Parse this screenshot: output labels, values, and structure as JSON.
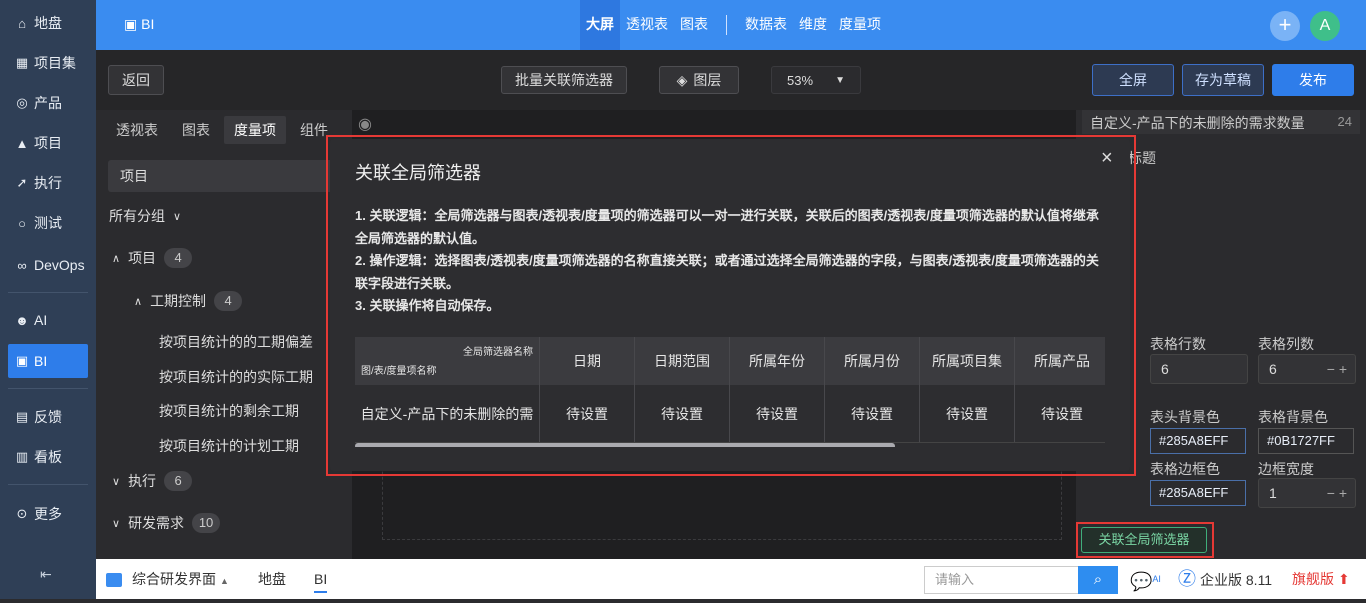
{
  "sidebar": {
    "items": [
      {
        "label": "地盘",
        "icon": "home-icon"
      },
      {
        "label": "项目集",
        "icon": "grid-icon"
      },
      {
        "label": "产品",
        "icon": "bulb-icon"
      },
      {
        "label": "项目",
        "icon": "rocket-icon"
      },
      {
        "label": "执行",
        "icon": "run-icon"
      },
      {
        "label": "测试",
        "icon": "search-icon"
      },
      {
        "label": "DevOps",
        "icon": "infinity-icon"
      },
      {
        "label": "AI",
        "icon": "robot-icon"
      },
      {
        "label": "BI",
        "icon": "chart-icon"
      },
      {
        "label": "反馈",
        "icon": "feedback-icon"
      },
      {
        "label": "看板",
        "icon": "board-icon"
      },
      {
        "label": "更多",
        "icon": "more-icon"
      }
    ],
    "active": "BI"
  },
  "topbar": {
    "brand": "BI",
    "tabs": [
      "大屏",
      "透视表",
      "图表",
      "数据表",
      "维度",
      "度量项"
    ],
    "active_tab": "大屏",
    "avatar_letter": "A",
    "plus": "+"
  },
  "toolbar": {
    "back": "返回",
    "batch_filter": "批量关联筛选器",
    "layers": "图层",
    "zoom": "53%",
    "fullscreen": "全屏",
    "save_draft": "存为草稿",
    "publish": "发布"
  },
  "left": {
    "tabs": [
      "透视表",
      "图表",
      "度量项",
      "组件"
    ],
    "active_tab": "度量项",
    "select_value": "项目",
    "group_label": "所有分组",
    "tree": {
      "project": {
        "label": "项目",
        "count": "4"
      },
      "schedule": {
        "label": "工期控制",
        "count": "4"
      },
      "leaves": [
        "按项目统计的的工期偏差",
        "按项目统计的的实际工期",
        "按项目统计的剩余工期",
        "按项目统计的计划工期"
      ],
      "exec": {
        "label": "执行",
        "count": "6"
      },
      "req": {
        "label": "研发需求",
        "count": "10"
      }
    }
  },
  "right": {
    "top_item": "自定义-产品下的未删除的需求数量",
    "top_num": "24",
    "title_label": "标题",
    "rows_label": "表格行数",
    "rows_value": "6",
    "cols_label": "表格列数",
    "cols_value": "6",
    "head_bg_label": "表头背景色",
    "head_bg_value": "#285A8EFF",
    "table_bg_label": "表格背景色",
    "table_bg_value": "#0B1727FF",
    "border_color_label": "表格边框色",
    "border_color_value": "#285A8EFF",
    "border_width_label": "边框宽度",
    "border_width_value": "1",
    "assoc_button": "关联全局筛选器"
  },
  "modal": {
    "title": "关联全局筛选器",
    "close": "×",
    "line1": "1. 关联逻辑：全局筛选器与图表/透视表/度量项的筛选器可以一对一进行关联，关联后的图表/透视表/度量项筛选器的默认值将继承全局筛选器的默认值。",
    "line2": "2. 操作逻辑：选择图表/透视表/度量项筛选器的名称直接关联；或者通过选择全局筛选器的字段，与图表/透视表/度量项筛选器的关联字段进行关联。",
    "line3": "3. 关联操作将自动保存。",
    "corner_top": "全局筛选器名称",
    "corner_bottom": "图/表/度量项名称",
    "columns": [
      "日期",
      "日期范围",
      "所属年份",
      "所属月份",
      "所属项目集",
      "所属产品"
    ],
    "row_name": "自定义-产品下的未删除的需",
    "row_values": [
      "待设置",
      "待设置",
      "待设置",
      "待设置",
      "待设置",
      "待设置"
    ]
  },
  "bottombar": {
    "workspace": "综合研发界面",
    "crumbs": [
      "地盘",
      "BI"
    ],
    "search_placeholder": "请输入",
    "ai_label": "AI",
    "edition": "企业版 8.11",
    "upgrade": "旗舰版"
  }
}
